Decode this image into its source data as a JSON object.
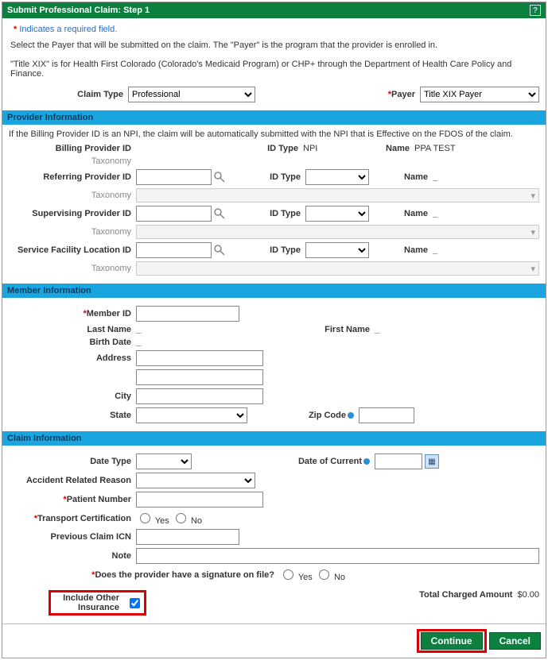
{
  "header": {
    "title": "Submit Professional Claim: Step 1"
  },
  "intro": {
    "required_note": "Indicates a required field.",
    "line1": "Select the Payer that will be submitted on the claim. The \"Payer\" is the program that the provider is enrolled in.",
    "line2": "\"Title XIX\" is for Health First Colorado (Colorado's Medicaid Program) or CHP+ through the Department of Health Care Policy and Finance.",
    "claim_type_label": "Claim Type",
    "claim_type_value": "Professional",
    "payer_label": "Payer",
    "payer_value": "Title XIX Payer"
  },
  "provider": {
    "section_title": "Provider Information",
    "npi_note": "If the Billing Provider ID is an NPI, the claim will be automatically submitted with the NPI that is Effective on the FDOS of the claim.",
    "billing_label": "Billing Provider ID",
    "idtype_label": "ID Type",
    "billing_idtype": "NPI",
    "name_label": "Name",
    "billing_name": "PPA TEST",
    "taxonomy_label": "Taxonomy",
    "referring_label": "Referring Provider ID",
    "supervising_label": "Supervising Provider ID",
    "facility_label": "Service Facility Location ID",
    "name_placeholder": "_"
  },
  "member": {
    "section_title": "Member Information",
    "member_id_label": "Member ID",
    "last_name_label": "Last Name",
    "last_name_value": "_",
    "first_name_label": "First Name",
    "first_name_value": "_",
    "birth_date_label": "Birth Date",
    "birth_date_value": "_",
    "address_label": "Address",
    "city_label": "City",
    "state_label": "State",
    "zip_label": "Zip Code"
  },
  "claim": {
    "section_title": "Claim Information",
    "date_type_label": "Date Type",
    "date_current_label": "Date of Current",
    "accident_label": "Accident Related Reason",
    "patient_number_label": "Patient Number",
    "transport_label": "Transport Certification",
    "yes": "Yes",
    "no": "No",
    "prev_icn_label": "Previous Claim ICN",
    "note_label": "Note",
    "signature_q": "Does the provider have a signature on file?",
    "include_other_label": "Include Other Insurance",
    "total_charged_label": "Total Charged Amount",
    "total_charged_value": "$0.00"
  },
  "buttons": {
    "continue": "Continue",
    "cancel": "Cancel"
  }
}
